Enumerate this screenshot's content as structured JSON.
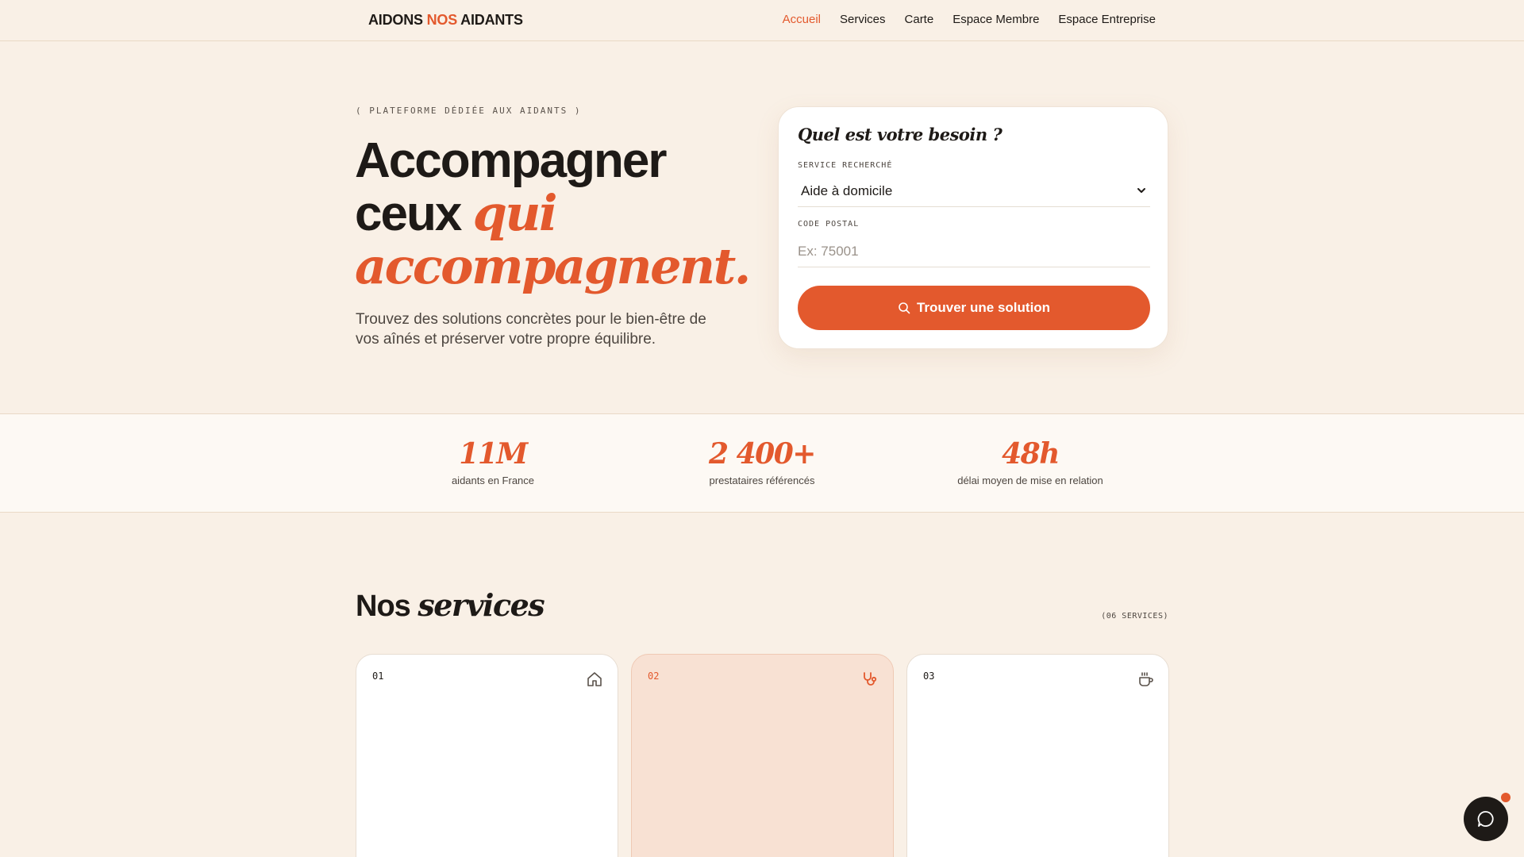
{
  "brand": {
    "part1": "AIDONS",
    "part2": "NOS",
    "part3": "AIDANTS",
    "accent_color": "#e3592d"
  },
  "nav": [
    {
      "label": "Accueil",
      "active": true
    },
    {
      "label": "Services"
    },
    {
      "label": "Carte"
    },
    {
      "label": "Espace Membre"
    },
    {
      "label": "Espace Entreprise"
    }
  ],
  "hero": {
    "eyebrow": "( PLATEFORME DÉDIÉE AUX AIDANTS )",
    "title_line1": "Accompagner",
    "title_line2_plain": "ceux",
    "title_line2_italic": "qui",
    "title_line3_italic": "accompagnent.",
    "subtitle": "Trouvez des solutions concrètes pour le bien-être de vos aînés et préserver votre propre équilibre."
  },
  "search": {
    "title": "Quel est votre besoin ?",
    "service_label": "SERVICE RECHERCHÉ",
    "service_value": "Aide à domicile",
    "postal_label": "CODE POSTAL",
    "postal_placeholder": "Ex: 75001",
    "button_label": "Trouver une solution"
  },
  "stats": [
    {
      "value": "11M",
      "label": "aidants en France"
    },
    {
      "value": "2 400+",
      "label": "prestataires référencés"
    },
    {
      "value": "48h",
      "label": "délai moyen de mise en relation"
    }
  ],
  "services": {
    "title_plain": "Nos",
    "title_italic": "services",
    "count": "(06 SERVICES)",
    "cards": [
      {
        "number": "01",
        "icon": "home-icon"
      },
      {
        "number": "02",
        "icon": "stethoscope-icon",
        "highlighted": true
      },
      {
        "number": "03",
        "icon": "coffee-cup-icon"
      }
    ]
  },
  "chat": {
    "icon": "chat-bubble-icon",
    "has_notification": true
  }
}
